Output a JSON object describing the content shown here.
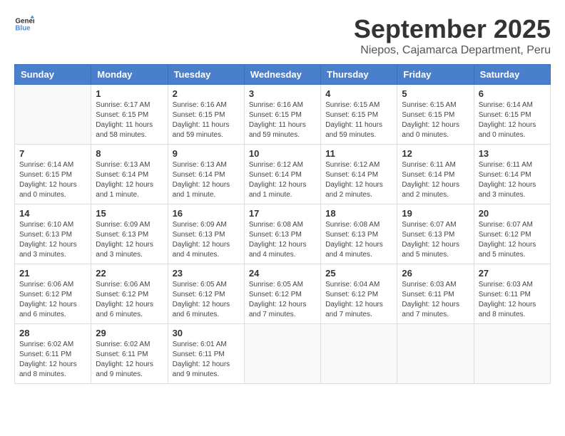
{
  "header": {
    "logo_general": "General",
    "logo_blue": "Blue",
    "month_title": "September 2025",
    "subtitle": "Niepos, Cajamarca Department, Peru"
  },
  "days_of_week": [
    "Sunday",
    "Monday",
    "Tuesday",
    "Wednesday",
    "Thursday",
    "Friday",
    "Saturday"
  ],
  "weeks": [
    [
      {
        "day": "",
        "content": ""
      },
      {
        "day": "1",
        "content": "Sunrise: 6:17 AM\nSunset: 6:15 PM\nDaylight: 11 hours\nand 58 minutes."
      },
      {
        "day": "2",
        "content": "Sunrise: 6:16 AM\nSunset: 6:15 PM\nDaylight: 11 hours\nand 59 minutes."
      },
      {
        "day": "3",
        "content": "Sunrise: 6:16 AM\nSunset: 6:15 PM\nDaylight: 11 hours\nand 59 minutes."
      },
      {
        "day": "4",
        "content": "Sunrise: 6:15 AM\nSunset: 6:15 PM\nDaylight: 11 hours\nand 59 minutes."
      },
      {
        "day": "5",
        "content": "Sunrise: 6:15 AM\nSunset: 6:15 PM\nDaylight: 12 hours\nand 0 minutes."
      },
      {
        "day": "6",
        "content": "Sunrise: 6:14 AM\nSunset: 6:15 PM\nDaylight: 12 hours\nand 0 minutes."
      }
    ],
    [
      {
        "day": "7",
        "content": "Sunrise: 6:14 AM\nSunset: 6:15 PM\nDaylight: 12 hours\nand 0 minutes."
      },
      {
        "day": "8",
        "content": "Sunrise: 6:13 AM\nSunset: 6:14 PM\nDaylight: 12 hours\nand 1 minute."
      },
      {
        "day": "9",
        "content": "Sunrise: 6:13 AM\nSunset: 6:14 PM\nDaylight: 12 hours\nand 1 minute."
      },
      {
        "day": "10",
        "content": "Sunrise: 6:12 AM\nSunset: 6:14 PM\nDaylight: 12 hours\nand 1 minute."
      },
      {
        "day": "11",
        "content": "Sunrise: 6:12 AM\nSunset: 6:14 PM\nDaylight: 12 hours\nand 2 minutes."
      },
      {
        "day": "12",
        "content": "Sunrise: 6:11 AM\nSunset: 6:14 PM\nDaylight: 12 hours\nand 2 minutes."
      },
      {
        "day": "13",
        "content": "Sunrise: 6:11 AM\nSunset: 6:14 PM\nDaylight: 12 hours\nand 3 minutes."
      }
    ],
    [
      {
        "day": "14",
        "content": "Sunrise: 6:10 AM\nSunset: 6:13 PM\nDaylight: 12 hours\nand 3 minutes."
      },
      {
        "day": "15",
        "content": "Sunrise: 6:09 AM\nSunset: 6:13 PM\nDaylight: 12 hours\nand 3 minutes."
      },
      {
        "day": "16",
        "content": "Sunrise: 6:09 AM\nSunset: 6:13 PM\nDaylight: 12 hours\nand 4 minutes."
      },
      {
        "day": "17",
        "content": "Sunrise: 6:08 AM\nSunset: 6:13 PM\nDaylight: 12 hours\nand 4 minutes."
      },
      {
        "day": "18",
        "content": "Sunrise: 6:08 AM\nSunset: 6:13 PM\nDaylight: 12 hours\nand 4 minutes."
      },
      {
        "day": "19",
        "content": "Sunrise: 6:07 AM\nSunset: 6:13 PM\nDaylight: 12 hours\nand 5 minutes."
      },
      {
        "day": "20",
        "content": "Sunrise: 6:07 AM\nSunset: 6:12 PM\nDaylight: 12 hours\nand 5 minutes."
      }
    ],
    [
      {
        "day": "21",
        "content": "Sunrise: 6:06 AM\nSunset: 6:12 PM\nDaylight: 12 hours\nand 6 minutes."
      },
      {
        "day": "22",
        "content": "Sunrise: 6:06 AM\nSunset: 6:12 PM\nDaylight: 12 hours\nand 6 minutes."
      },
      {
        "day": "23",
        "content": "Sunrise: 6:05 AM\nSunset: 6:12 PM\nDaylight: 12 hours\nand 6 minutes."
      },
      {
        "day": "24",
        "content": "Sunrise: 6:05 AM\nSunset: 6:12 PM\nDaylight: 12 hours\nand 7 minutes."
      },
      {
        "day": "25",
        "content": "Sunrise: 6:04 AM\nSunset: 6:12 PM\nDaylight: 12 hours\nand 7 minutes."
      },
      {
        "day": "26",
        "content": "Sunrise: 6:03 AM\nSunset: 6:11 PM\nDaylight: 12 hours\nand 7 minutes."
      },
      {
        "day": "27",
        "content": "Sunrise: 6:03 AM\nSunset: 6:11 PM\nDaylight: 12 hours\nand 8 minutes."
      }
    ],
    [
      {
        "day": "28",
        "content": "Sunrise: 6:02 AM\nSunset: 6:11 PM\nDaylight: 12 hours\nand 8 minutes."
      },
      {
        "day": "29",
        "content": "Sunrise: 6:02 AM\nSunset: 6:11 PM\nDaylight: 12 hours\nand 9 minutes."
      },
      {
        "day": "30",
        "content": "Sunrise: 6:01 AM\nSunset: 6:11 PM\nDaylight: 12 hours\nand 9 minutes."
      },
      {
        "day": "",
        "content": ""
      },
      {
        "day": "",
        "content": ""
      },
      {
        "day": "",
        "content": ""
      },
      {
        "day": "",
        "content": ""
      }
    ]
  ]
}
